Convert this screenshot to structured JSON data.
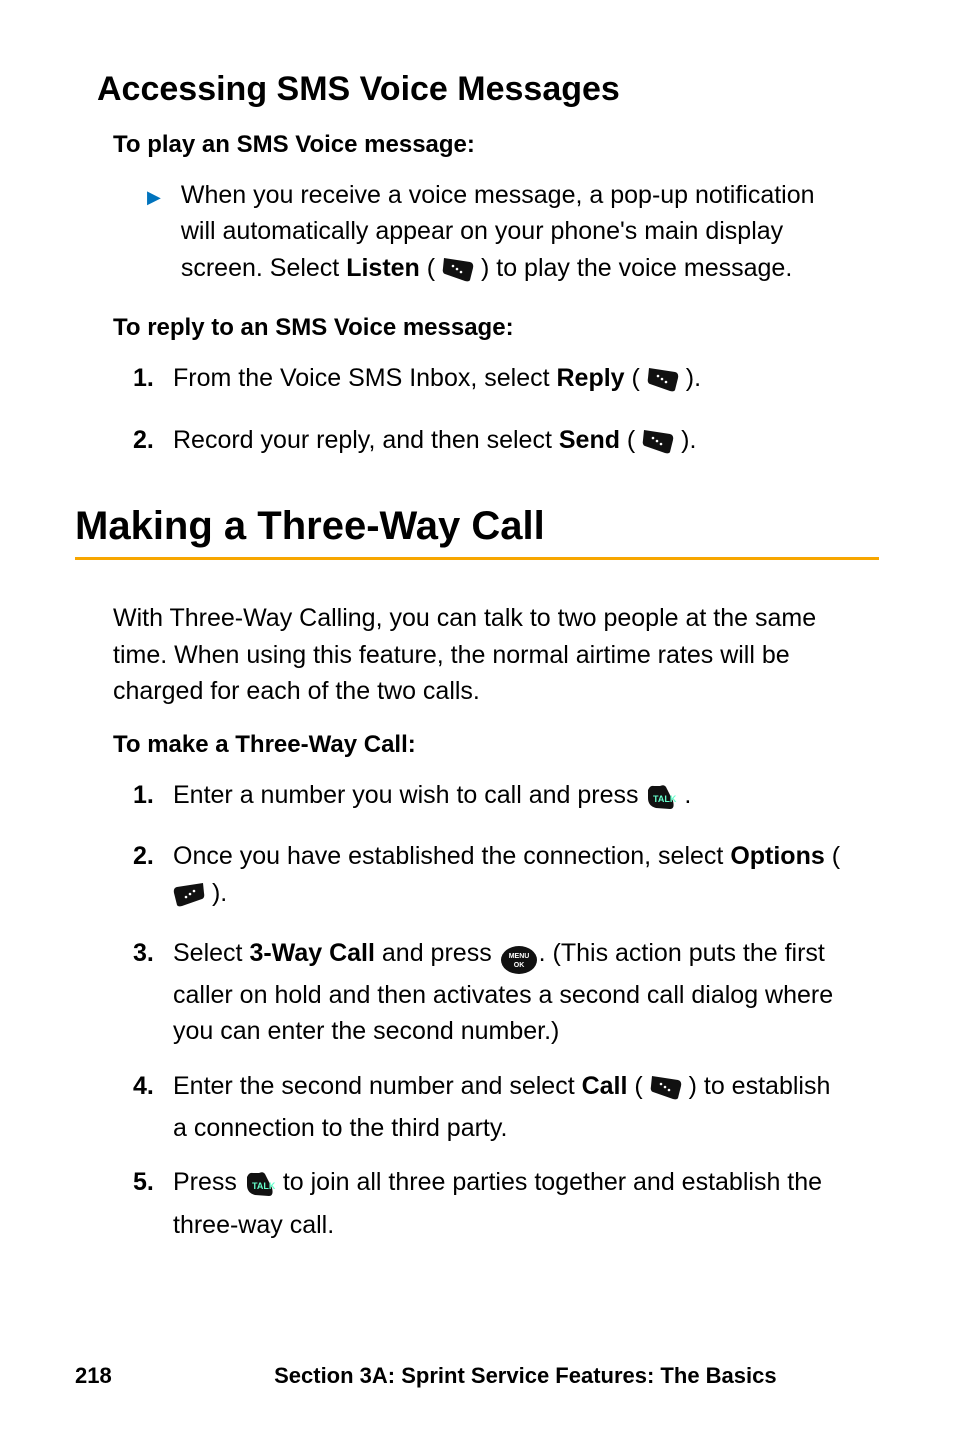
{
  "sms": {
    "heading": "Accessing SMS Voice Messages",
    "play_heading": "To play an SMS Voice message:",
    "bullet": {
      "pre": "When you receive a voice message, a pop-up notification will automatically appear on your phone's main display screen. Select ",
      "listen": "Listen",
      "post": " ) to play the voice message."
    },
    "reply_heading": "To reply to an SMS Voice message:",
    "step1": {
      "num": "1.",
      "pre": "From the Voice SMS Inbox, select ",
      "reply": "Reply",
      "post": " )."
    },
    "step2": {
      "num": "2.",
      "pre": "Record your reply, and then select ",
      "send": "Send",
      "post": " )."
    }
  },
  "threeway": {
    "section_heading": "Making a Three-Way Call",
    "intro": "With Three-Way Calling, you can talk to two people at the same time. When using this feature, the normal airtime rates will be charged for each of the two calls.",
    "make_heading": "To make a Three-Way Call:",
    "step1": {
      "num": "1.",
      "pre": "Enter a number you wish to call and press ",
      "post": " ."
    },
    "step2": {
      "num": "2.",
      "pre": "Once you have established the connection, select ",
      "options": "Options",
      "post": " )."
    },
    "step3": {
      "num": "3.",
      "pre": "Select ",
      "call": "3-Way Call",
      "mid": " and press ",
      "post": ". (This action puts the first caller on hold and then activates a second call dialog where you can enter the second number.)"
    },
    "step4": {
      "num": "4.",
      "pre": "Enter the second number and select ",
      "callbtn": "Call",
      "post": " ) to establish a connection to the third party."
    },
    "step5": {
      "num": "5.",
      "pre": "Press ",
      "post": " to join all three parties together and establish the three-way call."
    }
  },
  "footer": {
    "page": "218",
    "section": "Section 3A: Sprint Service Features: The Basics"
  }
}
